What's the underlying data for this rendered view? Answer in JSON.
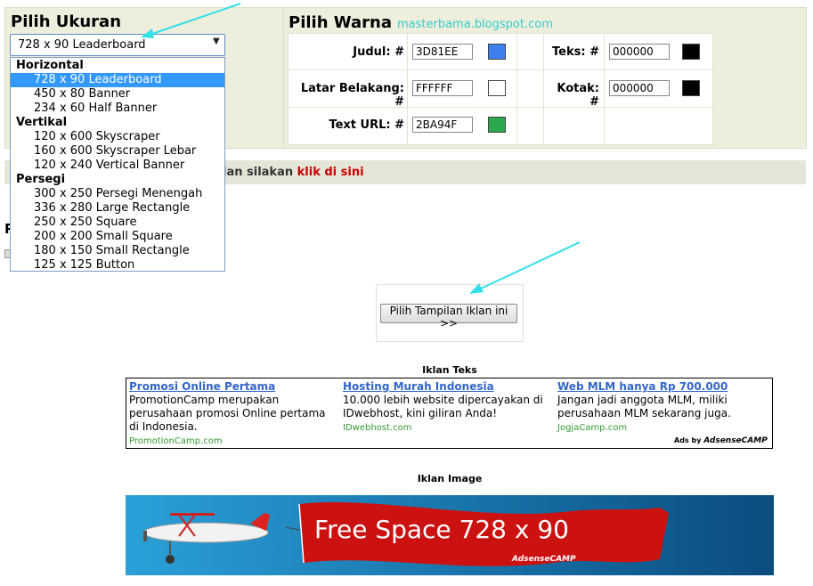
{
  "size_panel": {
    "heading": "Pilih Ukuran"
  },
  "color_panel": {
    "heading": "Pilih Warna",
    "watermark": "masterbama.blogspot.com",
    "fields": [
      {
        "label": "Judul: #",
        "value": "3D81EE",
        "color": "#3D81EE"
      },
      {
        "label": "Latar Belakang: #",
        "value": "FFFFFF",
        "color": "#FFFFFF"
      },
      {
        "label": "Text URL: #",
        "value": "2BA94F",
        "color": "#2BA94F"
      },
      {
        "label": "Teks: #",
        "value": "000000",
        "color": "#000000"
      },
      {
        "label": "Kotak: #",
        "value": "000000",
        "color": "#000000"
      }
    ]
  },
  "size_select": {
    "selected": "728 x 90 Leaderboard",
    "arrow_icon": "▼",
    "groups": [
      {
        "label": "Horizontal",
        "options": [
          "728 x 90 Leaderboard",
          "450 x 80 Banner",
          "234 x 60 Half Banner"
        ]
      },
      {
        "label": "Vertikal",
        "options": [
          "120 x 600 Skyscraper",
          "160 x 600 Skyscraper Lebar",
          "120 x 240 Vertical Banner"
        ]
      },
      {
        "label": "Persegi",
        "options": [
          "300 x 250 Persegi Menengah",
          "336 x 280 Large Rectangle",
          "250 x 250 Square",
          "200 x 200 Small Square",
          "180 x 150 Small Rectangle",
          "125 x 125 Button"
        ]
      }
    ]
  },
  "info_strip": {
    "text": "lan silakan ",
    "link": "klik di sini"
  },
  "stub": {
    "letter": "P"
  },
  "submit": {
    "label": "Pilih Tampilan Iklan ini >>"
  },
  "text_ads": {
    "title": "Iklan Teks",
    "ads": [
      {
        "title": "Promosi Online Pertama",
        "desc": "PromotionCamp merupakan perusahaan promosi Online pertama di Indonesia.",
        "url": "PromotionCamp.com"
      },
      {
        "title": "Hosting Murah Indonesia",
        "desc": "10.000 lebih website dipercayakan di IDwebhost, kini giliran Anda!",
        "url": "IDwebhost.com"
      },
      {
        "title": "Web MLM hanya Rp 700.000",
        "desc": "Jangan jadi anggota MLM, miliki perusahaan MLM sekarang juga.",
        "url": "JogjaCamp.com"
      }
    ],
    "ads_by": "Ads by ",
    "brand": "AdsenseCAMP"
  },
  "image_ad": {
    "title": "Iklan Image",
    "banner_text": "Free Space 728 x 90",
    "brand": "AdsenseCAMP",
    "colors": {
      "sky_top": "#2aa0d8",
      "sky_bottom": "#0a4c80",
      "banner_red": "#cc1111"
    }
  },
  "colors": {
    "panel_bg": "#eeeedd",
    "highlight": "#3399ff",
    "arrow": "#33e0e8",
    "link_red": "#cc0000",
    "ad_title": "#3366cc",
    "ad_url": "#339933"
  }
}
